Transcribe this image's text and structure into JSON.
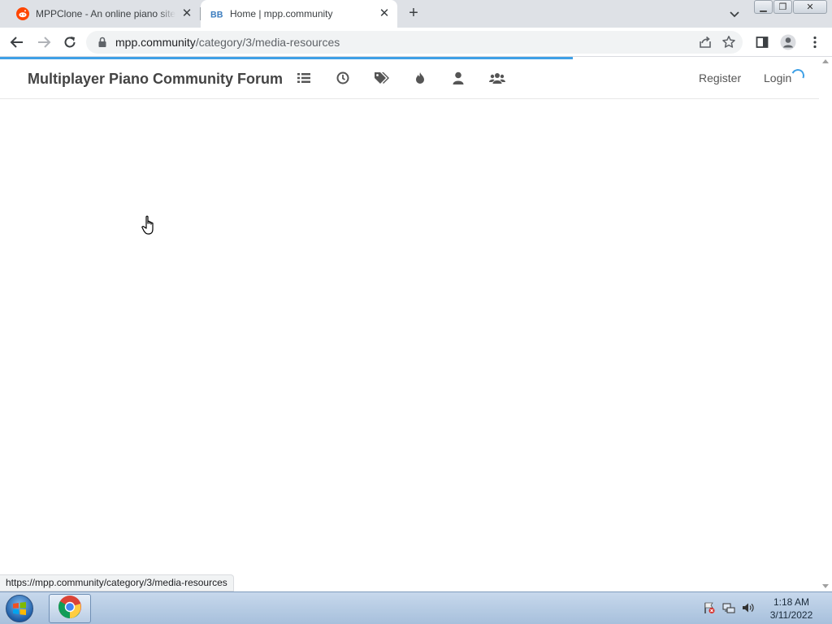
{
  "browser": {
    "tabs": [
      {
        "title": "MPPClone - An online piano site",
        "favicon": "reddit-icon",
        "active": false
      },
      {
        "title": "Home | mpp.community",
        "favicon": "nodebb-icon",
        "active": true
      }
    ],
    "new_tab_symbol": "+",
    "tab_close_symbol": "✕",
    "window_controls": {
      "minimize": "▁",
      "restore": "❐",
      "close": "✕"
    },
    "address": {
      "host": "mpp.community",
      "path": "/category/3/media-resources"
    },
    "status_url": "https://mpp.community/category/3/media-resources"
  },
  "site": {
    "brand": "Multiplayer Piano Community Forum",
    "nav_icons": [
      "list-icon",
      "clock-icon",
      "tags-icon",
      "fire-icon",
      "user-icon",
      "users-icon"
    ],
    "register_label": "Register",
    "login_label": "Login",
    "loading": true
  },
  "taskbar": {
    "time": "1:18 AM",
    "date": "3/11/2022"
  },
  "colors": {
    "accent": "#3fa0e6",
    "tab_strip": "#dee1e6",
    "reddit": "#ff4500",
    "nodebb": "#3c7dbf"
  }
}
